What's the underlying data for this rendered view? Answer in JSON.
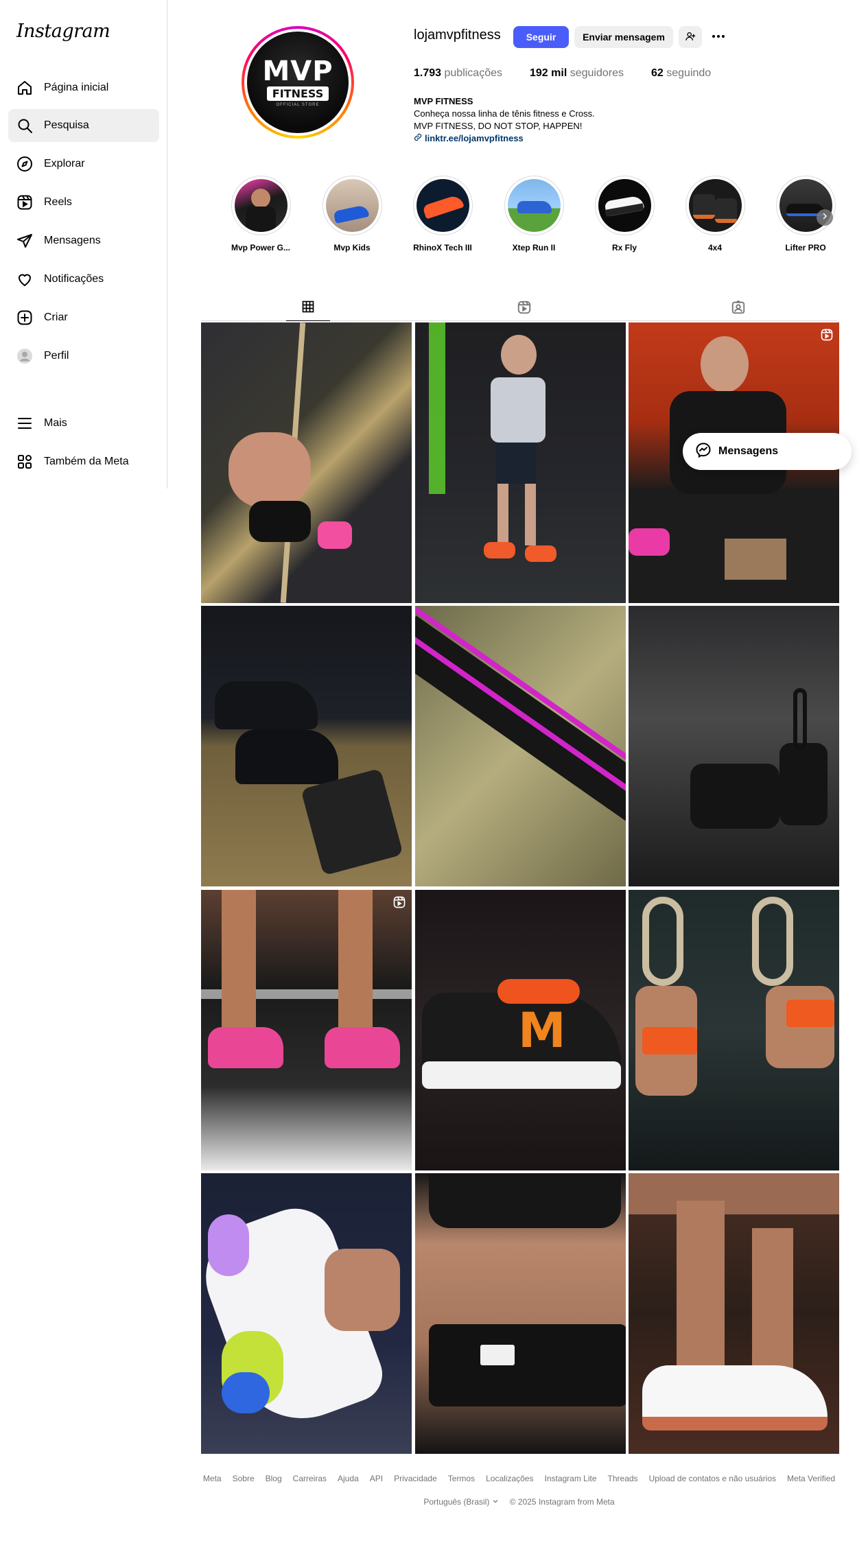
{
  "app": {
    "logo": "Instagram"
  },
  "sidebar": {
    "items": [
      {
        "label": "Página inicial",
        "icon": "home-icon"
      },
      {
        "label": "Pesquisa",
        "icon": "search-icon",
        "active": true
      },
      {
        "label": "Explorar",
        "icon": "compass-icon"
      },
      {
        "label": "Reels",
        "icon": "reels-icon"
      },
      {
        "label": "Mensagens",
        "icon": "send-icon"
      },
      {
        "label": "Notificações",
        "icon": "heart-icon"
      },
      {
        "label": "Criar",
        "icon": "plus-square-icon"
      },
      {
        "label": "Perfil",
        "icon": "avatar-icon"
      }
    ],
    "more": {
      "label": "Mais",
      "icon": "menu-icon"
    },
    "meta": {
      "label": "Também da Meta",
      "icon": "grid-icon"
    }
  },
  "profile": {
    "avatar_text": {
      "mvp": "MVP",
      "fitness": "FITNESS",
      "sub": "OFFICIAL STORE"
    },
    "username": "lojamvpfitness",
    "follow_label": "Seguir",
    "message_label": "Enviar mensagem",
    "stats": [
      {
        "num": "1.793",
        "label": "publicações"
      },
      {
        "num": "192 mil",
        "label": "seguidores"
      },
      {
        "num": "62",
        "label": "seguindo"
      }
    ],
    "bio": {
      "name": "MVP FITNESS",
      "line1": "Conheça nossa linha de tênis fitness e Cross.",
      "line2": "MVP FITNESS, DO NOT STOP, HAPPEN!",
      "link": "linktr.ee/lojamvpfitness"
    }
  },
  "highlights": [
    {
      "label": "Mvp Power G..."
    },
    {
      "label": "Mvp Kids"
    },
    {
      "label": "RhinoX Tech III"
    },
    {
      "label": "Xtep Run II"
    },
    {
      "label": "Rx Fly"
    },
    {
      "label": "4x4"
    },
    {
      "label": "Lifter PRO"
    }
  ],
  "floating": {
    "messages_label": "Mensagens"
  },
  "footer": {
    "links": [
      "Meta",
      "Sobre",
      "Blog",
      "Carreiras",
      "Ajuda",
      "API",
      "Privacidade",
      "Termos",
      "Localizações",
      "Instagram Lite",
      "Threads",
      "Upload de contatos e não usuários",
      "Meta Verified"
    ],
    "language": "Português (Brasil)",
    "copyright": "© 2025 Instagram from Meta"
  },
  "colors": {
    "accent": "#4a5df9",
    "link": "#00376b",
    "muted": "#737373"
  }
}
